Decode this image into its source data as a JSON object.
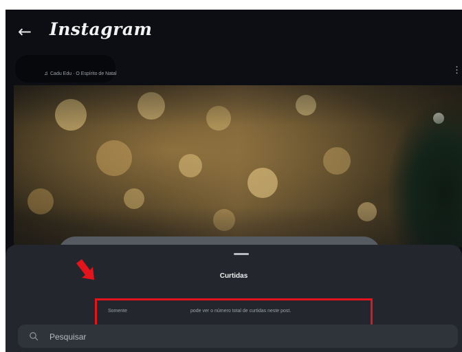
{
  "header": {
    "back_glyph": "←",
    "back_icon": "arrow-left-icon",
    "app_title": "Instagram"
  },
  "post": {
    "music_icon": "music-note-icon",
    "music_label": "Cadu Edu · O Espírito de Natal",
    "more_icon": "kebab-menu-icon"
  },
  "likes_sheet": {
    "title": "Curtidas",
    "info_part1": "Somente",
    "info_part2": "pode ver o número total de curtidas neste post.",
    "highlight_color": "#e3141b"
  },
  "search": {
    "placeholder": "Pesquisar",
    "icon": "search-icon"
  },
  "annotation": {
    "arrow_icon": "red-arrow-icon",
    "arrow_color": "#e3141b"
  }
}
